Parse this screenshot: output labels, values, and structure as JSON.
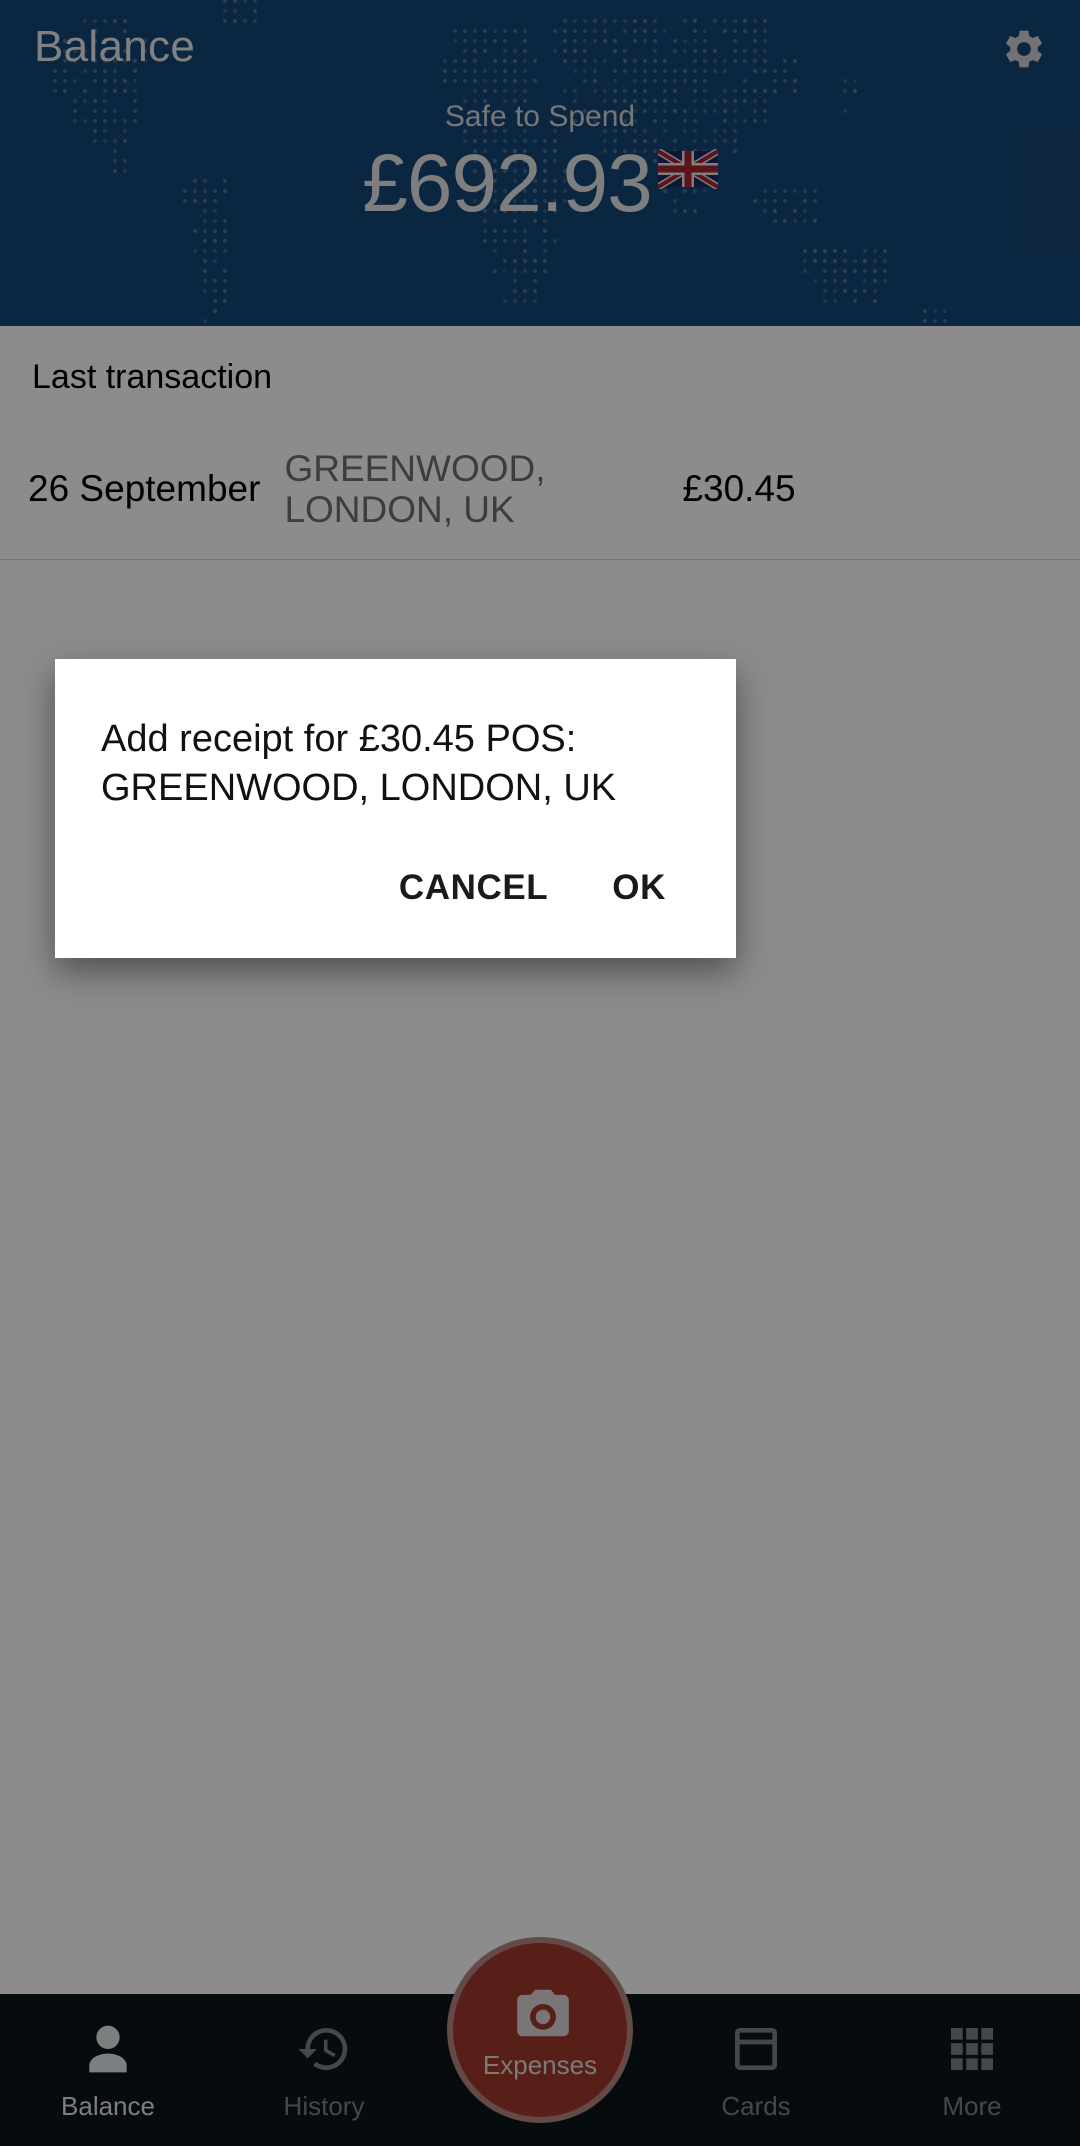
{
  "header": {
    "title": "Balance",
    "settings_icon": "gear-icon",
    "safe_to_spend_label": "Safe to Spend",
    "balance_amount": "£692.93",
    "currency_flag": "uk-flag",
    "background_color": "#154675",
    "map_pattern": "dotted-world-map"
  },
  "transactions": {
    "section_title": "Last transaction",
    "columns": [
      "date",
      "description",
      "amount"
    ],
    "rows": [
      {
        "date": "26 September",
        "description": "GREENWOOD, LONDON, UK",
        "amount": "£30.45"
      }
    ]
  },
  "dialog": {
    "message": "Add receipt for £30.45 POS: GREENWOOD, LONDON, UK",
    "message_line1": "Add receipt for £30.45 POS:",
    "message_line2": "GREENWOOD, LONDON, UK",
    "cancel_label": "CANCEL",
    "ok_label": "OK"
  },
  "bottom_nav": {
    "items": [
      {
        "label": "Balance",
        "icon": "person-icon",
        "active": true
      },
      {
        "label": "History",
        "icon": "history-clock-icon",
        "active": false
      },
      {
        "label": "Expenses",
        "icon": "camera-icon",
        "active": false
      },
      {
        "label": "Cards",
        "icon": "credit-card-icon",
        "active": false
      },
      {
        "label": "More",
        "icon": "grid-menu-icon",
        "active": false
      }
    ],
    "fab_color": "#a03a2c",
    "background_color": "#0b1519"
  }
}
